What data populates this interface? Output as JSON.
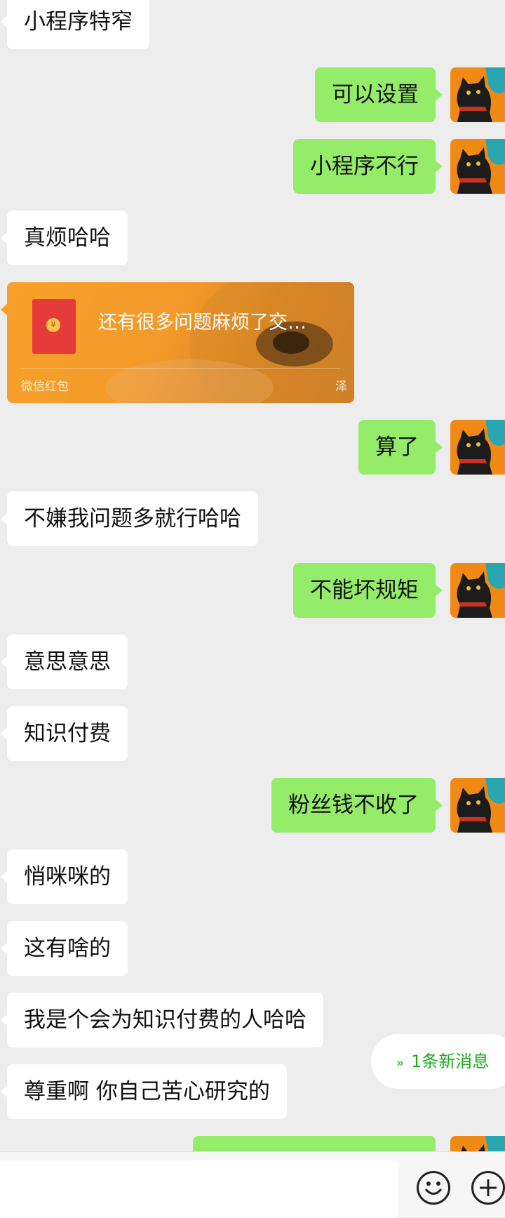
{
  "messages": [
    {
      "side": "left",
      "text": "小程序特窄"
    },
    {
      "side": "right",
      "text": "可以设置"
    },
    {
      "side": "right",
      "text": "小程序不行"
    },
    {
      "side": "left",
      "text": "真烦哈哈"
    },
    {
      "side": "right",
      "text": "算了"
    },
    {
      "side": "left",
      "text": "不嫌我问题多就行哈哈"
    },
    {
      "side": "right",
      "text": "不能坏规矩"
    },
    {
      "side": "left",
      "text": "意思意思"
    },
    {
      "side": "left",
      "text": "知识付费"
    },
    {
      "side": "right",
      "text": "粉丝钱不收了"
    },
    {
      "side": "left",
      "text": "悄咪咪的"
    },
    {
      "side": "left",
      "text": "这有啥的"
    },
    {
      "side": "left",
      "text": "我是个会为知识付费的人哈哈"
    },
    {
      "side": "left",
      "text": "尊重啊 你自己苦心研究的"
    }
  ],
  "red_packet": {
    "message": "还有很多问题麻烦了交…",
    "label": "微信红包",
    "sender_mark": "泽",
    "coin_glyph": "¥"
  },
  "new_message_pill": {
    "chevron": "»",
    "text": "1条新消息"
  },
  "colors": {
    "background": "#ededed",
    "incoming_bubble": "#ffffff",
    "outgoing_bubble": "#95ec69",
    "red_packet": "#f39a2a",
    "accent": "#1aad19"
  },
  "icons": {
    "avatar": "black-cat-avatar-icon",
    "emoji": "emoji-icon",
    "plus": "plus-icon"
  }
}
